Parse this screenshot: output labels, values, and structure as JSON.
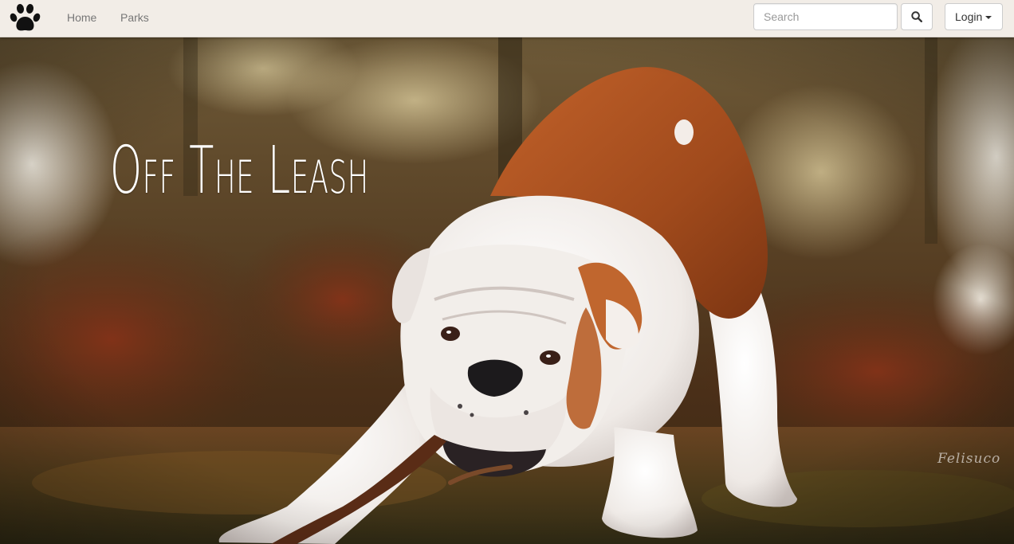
{
  "nav": {
    "brand_icon": "paw-icon",
    "links": [
      {
        "label": "Home"
      },
      {
        "label": "Parks"
      }
    ],
    "search": {
      "placeholder": "Search",
      "value": "",
      "button_icon": "search-icon"
    },
    "login": {
      "label": "Login",
      "icon": "caret-down-icon"
    }
  },
  "hero": {
    "title": "Off The Leash",
    "watermark": "Felisuco"
  },
  "colors": {
    "navbar_bg": "#f2ede7",
    "link": "#777777",
    "title": "#ffffff"
  }
}
